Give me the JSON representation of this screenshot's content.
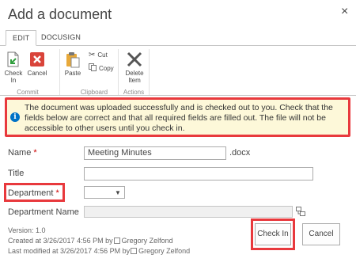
{
  "dialog": {
    "title": "Add a document",
    "close_glyph": "×"
  },
  "ribbon": {
    "tabs": [
      {
        "label": "EDIT",
        "active": true
      },
      {
        "label": "DOCUSIGN",
        "active": false
      }
    ],
    "buttons": {
      "check_in": "Check In",
      "cancel": "Cancel",
      "paste": "Paste",
      "cut": "Cut",
      "copy": "Copy",
      "delete_item": "Delete Item"
    },
    "groups": {
      "commit": "Commit",
      "clipboard": "Clipboard",
      "actions": "Actions"
    }
  },
  "message": {
    "icon": "i",
    "text": "The document was uploaded successfully and is checked out to you. Check that the fields below are correct and that all required fields are filled out. The file will not be accessible to other users until you check in."
  },
  "form": {
    "name": {
      "label": "Name",
      "required": "*",
      "value": "Meeting Minutes",
      "extension": ".docx"
    },
    "title": {
      "label": "Title",
      "value": ""
    },
    "department": {
      "label": "Department",
      "required": "*",
      "value": "",
      "arrow": "▼"
    },
    "department_name": {
      "label": "Department Name",
      "value": ""
    }
  },
  "meta": {
    "version": "Version: 1.0",
    "created": "Created at 3/26/2017 4:56 PM  by",
    "created_by": "Gregory Zelfond",
    "modified": "Last modified at 3/26/2017 4:56 PM  by",
    "modified_by": "Gregory Zelfond"
  },
  "actions": {
    "check_in": "Check In",
    "cancel": "Cancel"
  },
  "colors": {
    "highlight_border": "#e8393d",
    "info_blue": "#0072c6",
    "message_bg": "#fdf8d9"
  }
}
